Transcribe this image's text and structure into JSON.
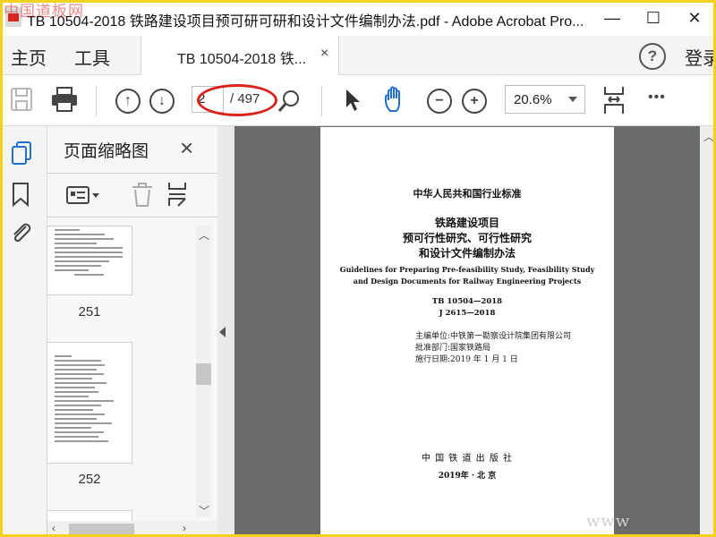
{
  "window": {
    "title": "TB 10504-2018 铁路建设项目预可研可研和设计文件编制办法.pdf - Adobe Acrobat Pro...",
    "minimize": "—",
    "maximize": "☐",
    "close": "✕",
    "watermark": "中国道板网"
  },
  "tabs": {
    "home": "主页",
    "tools": "工具",
    "document": "TB 10504-2018 铁...",
    "close": "×",
    "help": "?",
    "login": "登录"
  },
  "toolbar": {
    "current_page": "2",
    "total_pages": "/ 497",
    "zoom": "20.6%",
    "more": "•••",
    "highlight_color": "#d9221c"
  },
  "thumbnail_panel": {
    "title": "页面缩略图",
    "close": "×",
    "pages": [
      "251",
      "252"
    ]
  },
  "page": {
    "standard": "中华人民共和国行业标准",
    "title_line1": "铁路建设项目",
    "title_line2": "预可行性研究、可行性研究",
    "title_line3": "和设计文件编制办法",
    "english_line1": "Guidelines for Preparing Pre-feasibility Study, Feasibility Study",
    "english_line2": "and Design Documents for Railway Engineering Projects",
    "code1": "TB 10504—2018",
    "code2": "J 2615—2018",
    "editor": "主编单位:中铁第一勘察设计院集团有限公司",
    "approver": "批准部门:国家铁路局",
    "effective": "施行日期:2019 年 1 月 1 日",
    "publisher": "中 国 铁 道 出 版 社",
    "pub_date": "2019年 · 北 京"
  },
  "footer": {
    "watermark": "www"
  }
}
